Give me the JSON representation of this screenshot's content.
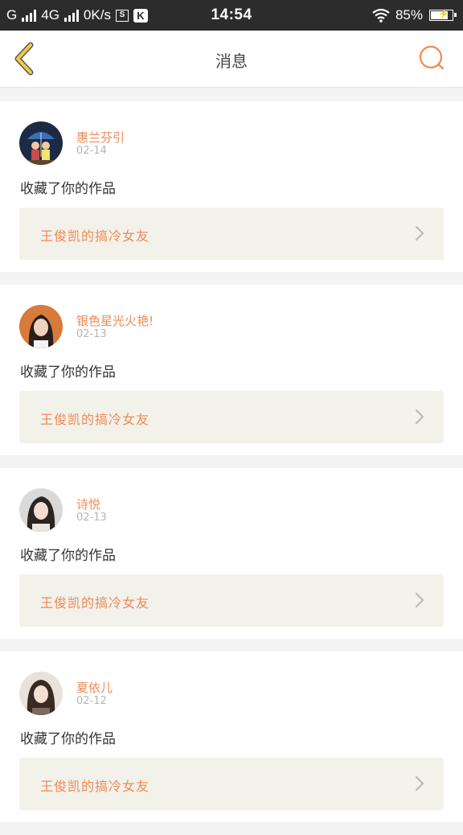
{
  "status_bar": {
    "carrier1": "G",
    "carrier2": "4G",
    "speed": "0K/s",
    "s_icon_label": "S",
    "k_icon_label": "K",
    "time": "14:54",
    "battery": "85%",
    "battery_level": 0.85
  },
  "header": {
    "title": "消息",
    "back_icon": "chevron-left-icon",
    "search_icon": "search-icon",
    "accent_color": "#ef8a55",
    "back_color": "#f5c842"
  },
  "messages": [
    {
      "username": "惠兰芬引",
      "date": "02-14",
      "action": "收藏了你的作品",
      "work_title": "王俊凯的搞冷女友",
      "avatar": "avatar-umbrella-couple"
    },
    {
      "username": "银色星光火艳!",
      "date": "02-13",
      "action": "收藏了你的作品",
      "work_title": "王俊凯的搞冷女友",
      "avatar": "avatar-girl-orange"
    },
    {
      "username": "诗悦",
      "date": "02-13",
      "action": "收藏了你的作品",
      "work_title": "王俊凯的搞冷女友",
      "avatar": "avatar-girl-dark-hair"
    },
    {
      "username": "夏依儿",
      "date": "02-12",
      "action": "收藏了你的作品",
      "work_title": "王俊凯的搞冷女友",
      "avatar": "avatar-girl-long-hair"
    }
  ]
}
